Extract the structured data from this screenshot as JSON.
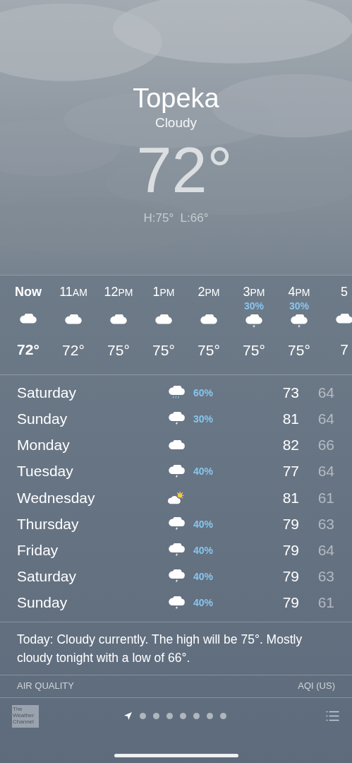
{
  "header": {
    "city": "Topeka",
    "condition": "Cloudy",
    "temperature": "72°",
    "high_low": "H:75°  L:66°"
  },
  "hourly": [
    {
      "hour": "Now",
      "current": true,
      "kind": "cloud",
      "temp": "72°"
    },
    {
      "hour": "11",
      "suffix": "AM",
      "current": false,
      "kind": "cloud",
      "temp": "72°"
    },
    {
      "hour": "12",
      "suffix": "PM",
      "current": false,
      "kind": "cloud",
      "temp": "75°"
    },
    {
      "hour": "1",
      "suffix": "PM",
      "current": false,
      "kind": "cloud",
      "temp": "75°"
    },
    {
      "hour": "2",
      "suffix": "PM",
      "current": false,
      "kind": "cloud",
      "temp": "75°"
    },
    {
      "hour": "3",
      "suffix": "PM",
      "current": false,
      "precip": "30%",
      "kind": "thunder",
      "temp": "75°"
    },
    {
      "hour": "4",
      "suffix": "PM",
      "current": false,
      "precip": "30%",
      "kind": "thunder",
      "temp": "75°"
    },
    {
      "hour": "5",
      "current": false,
      "kind": "cloud",
      "temp": "7"
    }
  ],
  "daily": [
    {
      "day": "Saturday",
      "kind": "rain",
      "precip": "60%",
      "high": "73",
      "low": "64"
    },
    {
      "day": "Sunday",
      "kind": "thunder",
      "precip": "30%",
      "high": "81",
      "low": "64"
    },
    {
      "day": "Monday",
      "kind": "cloud",
      "high": "82",
      "low": "66"
    },
    {
      "day": "Tuesday",
      "kind": "thunder",
      "precip": "40%",
      "high": "77",
      "low": "64"
    },
    {
      "day": "Wednesday",
      "kind": "partly-sunny",
      "high": "81",
      "low": "61"
    },
    {
      "day": "Thursday",
      "kind": "thunder",
      "precip": "40%",
      "high": "79",
      "low": "63"
    },
    {
      "day": "Friday",
      "kind": "thunder",
      "precip": "40%",
      "high": "79",
      "low": "64"
    },
    {
      "day": "Saturday",
      "kind": "thunder",
      "precip": "40%",
      "high": "79",
      "low": "63"
    },
    {
      "day": "Sunday",
      "kind": "thunder",
      "precip": "40%",
      "high": "79",
      "low": "61"
    }
  ],
  "summary": "Today: Cloudy currently. The high will be 75°. Mostly cloudy tonight with a low of 66°.",
  "air_quality": {
    "title": "AIR QUALITY",
    "unit": "AQI (US)"
  },
  "toolbar": {
    "logo_text": "The Weather Channel",
    "pages": [
      {
        "kind": "location",
        "selected": true
      },
      {
        "kind": "dot",
        "selected": false
      },
      {
        "kind": "dot",
        "selected": false
      },
      {
        "kind": "dot",
        "selected": false
      },
      {
        "kind": "dot",
        "selected": false
      },
      {
        "kind": "dot",
        "selected": false
      },
      {
        "kind": "dot",
        "selected": false
      },
      {
        "kind": "dot",
        "selected": false
      }
    ]
  }
}
